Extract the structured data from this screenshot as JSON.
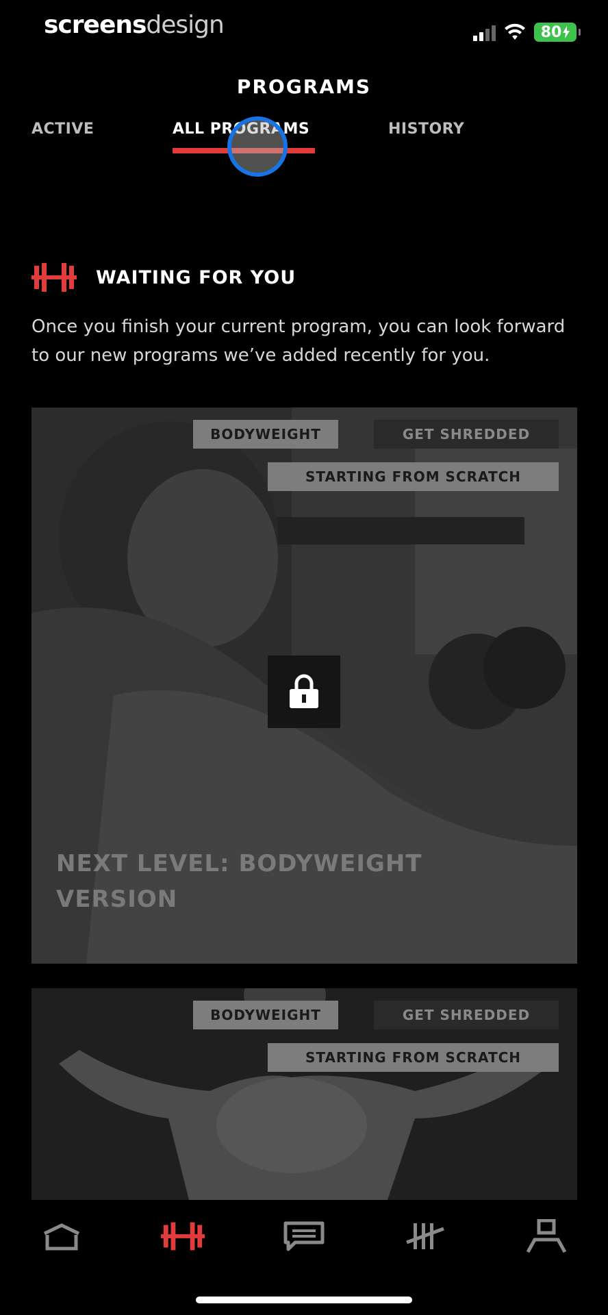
{
  "status_bar": {
    "brand_part1": "screens",
    "brand_part2": "design",
    "battery": "80"
  },
  "page_title": "PROGRAMS",
  "tabs": [
    {
      "label": "ACTIVE"
    },
    {
      "label": "ALL PROGRAMS"
    },
    {
      "label": "HISTORY"
    }
  ],
  "section": {
    "title": "WAITING FOR YOU",
    "description": "Once you finish your current program, you can look forward to our new programs we’ve added recently for you."
  },
  "cards": [
    {
      "tags": [
        "BODYWEIGHT",
        "GET SHREDDED",
        "STARTING FROM SCRATCH"
      ],
      "title": "NEXT LEVEL: BODYWEIGHT VERSION"
    },
    {
      "tags": [
        "BODYWEIGHT",
        "GET SHREDDED",
        "STARTING FROM SCRATCH"
      ]
    }
  ],
  "bottom_nav": [
    {
      "icon": "home-icon"
    },
    {
      "icon": "dumbbell-icon"
    },
    {
      "icon": "chat-icon"
    },
    {
      "icon": "tally-icon"
    },
    {
      "icon": "profile-icon"
    }
  ],
  "colors": {
    "accent": "#e23b3b",
    "background": "#000000",
    "touch": "#1774e6"
  }
}
